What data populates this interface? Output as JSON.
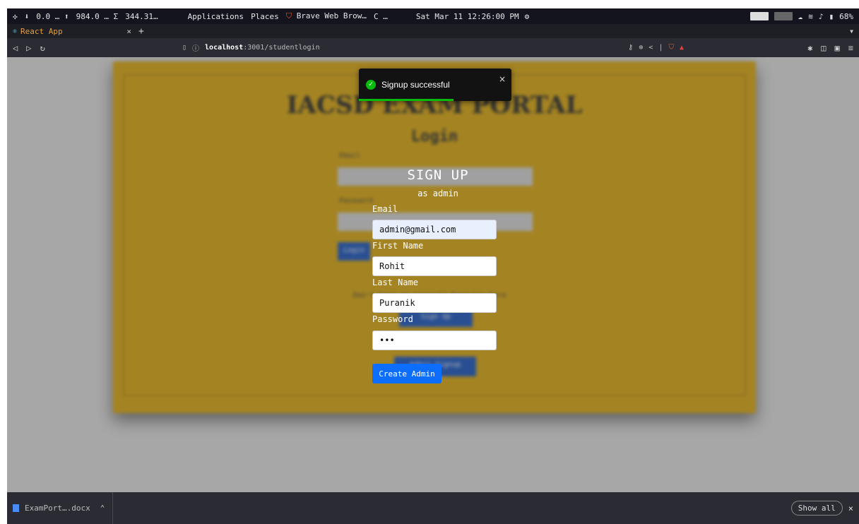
{
  "os_panel": {
    "net_down": "⬇",
    "cpu": "0.0 … ⬆",
    "mem": "984.0 … Σ",
    "disk": "344.31…",
    "menu_apps": "Applications",
    "menu_places": "Places",
    "active_app": "Brave Web Brow…",
    "loading": "C …",
    "clock": "Sat Mar 11 12:26:00 PM",
    "battery": "68%"
  },
  "browser": {
    "tab_title": "React App",
    "tab_close": "×",
    "new_tab": "+",
    "url_host": "localhost",
    "url_path": ":3001/studentlogin"
  },
  "background_page": {
    "title": "IACSD EXAM PORTAL",
    "heading": "Login",
    "email_label": "Email",
    "password_label": "Password",
    "login_button": "Login",
    "register_text": "Don't have an account? Register here",
    "signup_button": "Sign Up",
    "admin_button": "Admin Signup"
  },
  "toast": {
    "message": "Signup successful",
    "close": "×",
    "progress": 0.62
  },
  "signup": {
    "title": "SIGN UP",
    "subtitle": "as admin",
    "email_label": "Email",
    "email_value": "admin@gmail.com",
    "first_name_label": "First Name",
    "first_name_value": "Rohit",
    "last_name_label": "Last Name",
    "last_name_value": "Puranik",
    "password_label": "Password",
    "password_value": "•••",
    "submit_label": "Create Admin"
  },
  "downloads": {
    "file_name": "ExamPort….docx",
    "show_all": "Show all",
    "close": "×"
  },
  "colors": {
    "card": "#e0a800",
    "primary_button": "#0d6efd",
    "toast_success": "#07bc0c"
  }
}
